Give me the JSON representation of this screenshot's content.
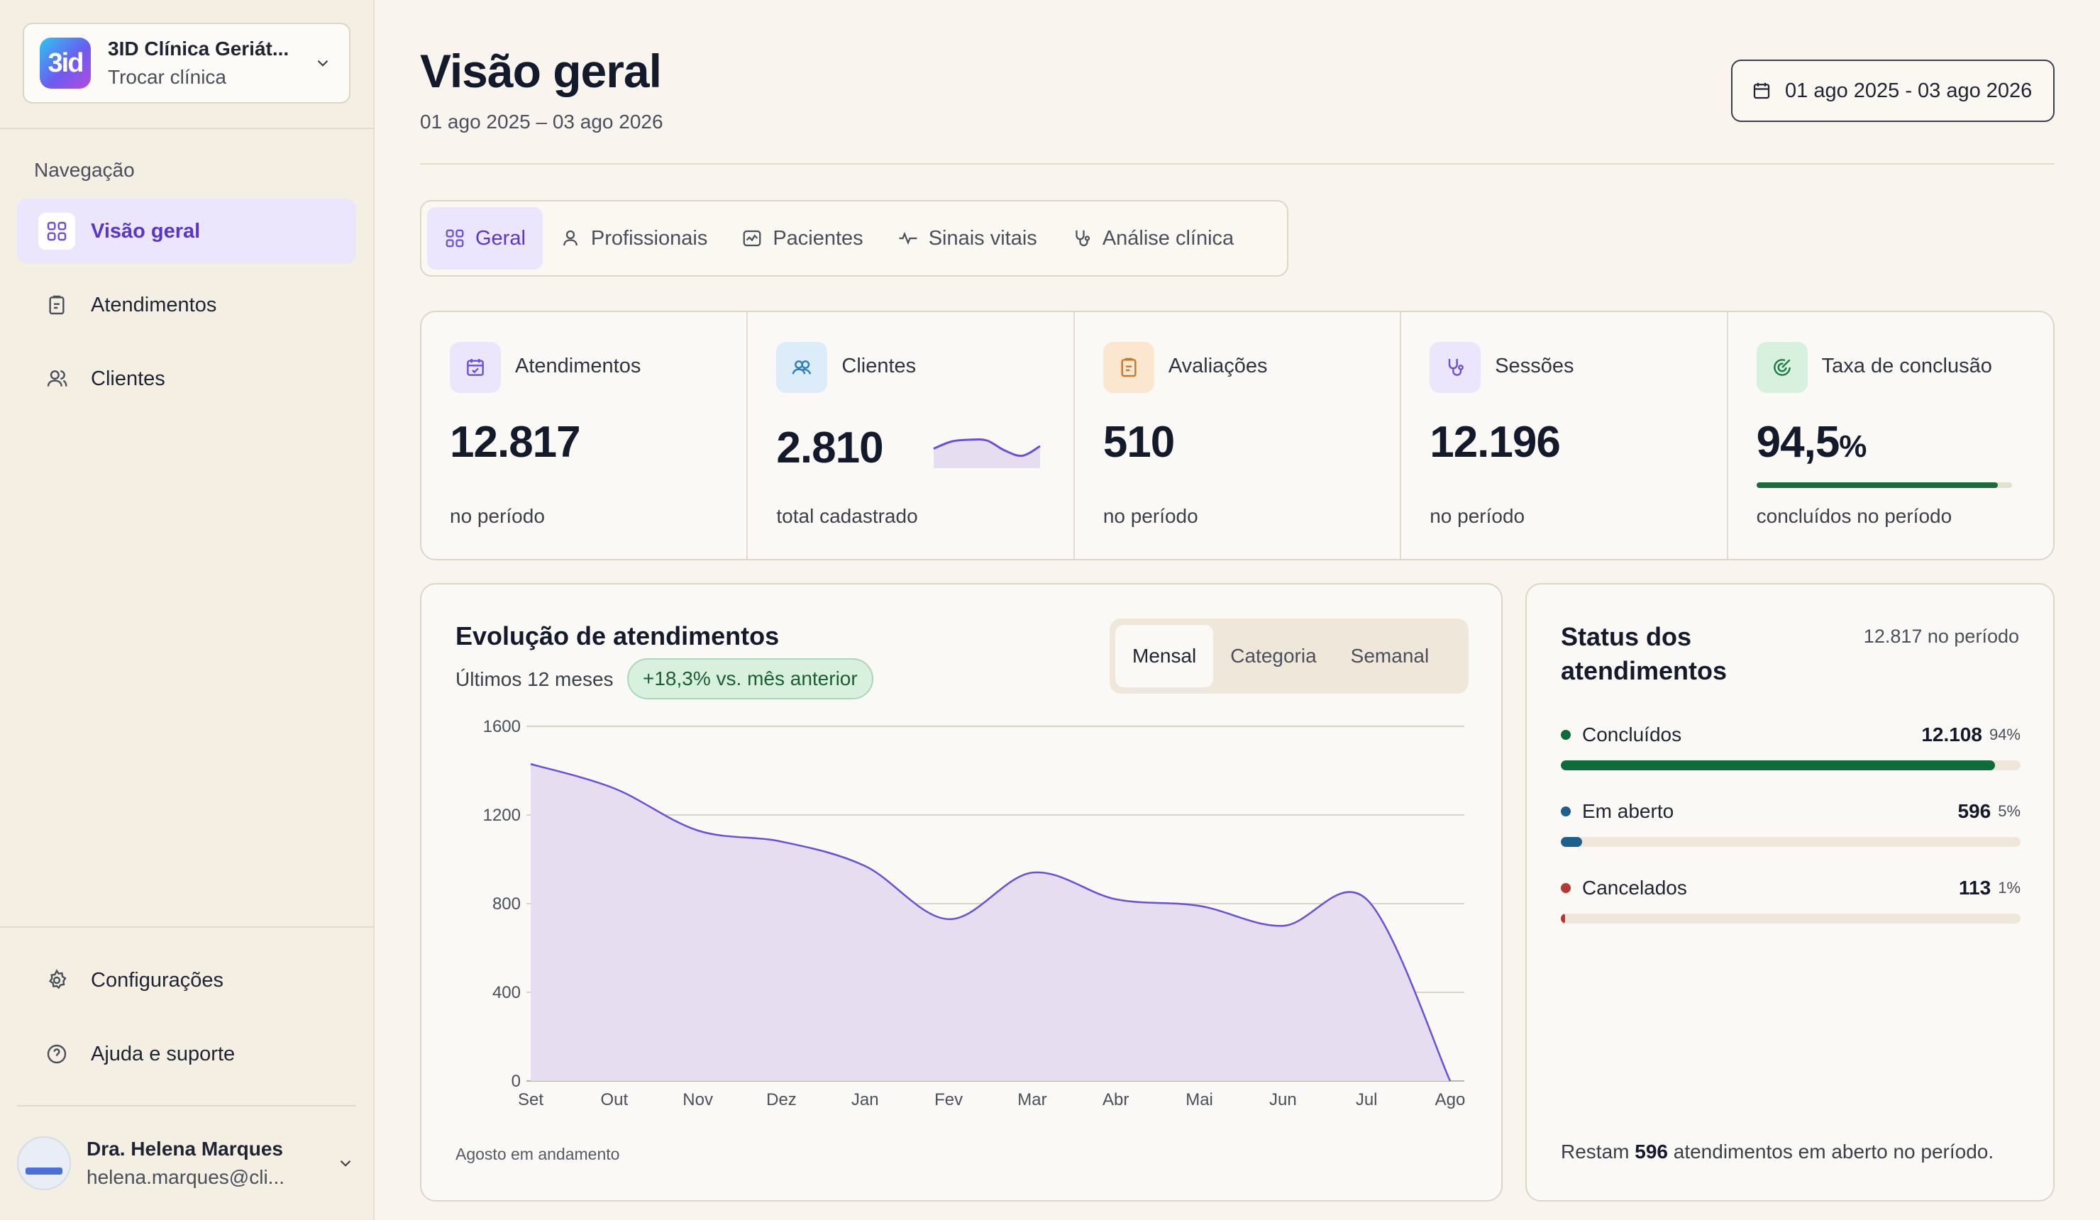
{
  "sidebar": {
    "clinic": {
      "logo_text": "3id",
      "name": "3ID Clínica Geriát...",
      "switch_label": "Trocar clínica"
    },
    "nav_title": "Navegação",
    "items": [
      {
        "label": "Visão geral",
        "icon": "grid-icon",
        "active": true
      },
      {
        "label": "Atendimentos",
        "icon": "clipboard-icon",
        "active": false
      },
      {
        "label": "Clientes",
        "icon": "users-icon",
        "active": false
      }
    ],
    "bottom_items": [
      {
        "label": "Configurações",
        "icon": "gear-icon"
      },
      {
        "label": "Ajuda e suporte",
        "icon": "help-icon"
      }
    ],
    "user": {
      "name": "Dra. Helena Marques",
      "email": "helena.marques@cli..."
    }
  },
  "header": {
    "title": "Visão geral",
    "subtitle": "01 ago 2025 – 03 ago 2026",
    "date_range_button": "01 ago 2025 - 03 ago 2026"
  },
  "tabs": [
    {
      "label": "Geral",
      "icon": "grid-icon",
      "active": true
    },
    {
      "label": "Profissionais",
      "icon": "user-icon",
      "active": false
    },
    {
      "label": "Pacientes",
      "icon": "activity-card-icon",
      "active": false
    },
    {
      "label": "Sinais vitais",
      "icon": "pulse-icon",
      "active": false
    },
    {
      "label": "Análise clínica",
      "icon": "stethoscope-icon",
      "active": false
    }
  ],
  "stats": [
    {
      "label": "Atendimentos",
      "value": "12.817",
      "foot": "no período",
      "icon": "calendar-check-icon",
      "color": "#6b4fd8",
      "bg": "#ebe6fb"
    },
    {
      "label": "Clientes",
      "value": "2.810",
      "foot": "total cadastrado",
      "icon": "users-icon",
      "color": "#2a7fb8",
      "bg": "#dcecf8",
      "sparkline": [
        0.55,
        0.75,
        0.8,
        0.78,
        0.5,
        0.35,
        0.62
      ]
    },
    {
      "label": "Avaliações",
      "value": "510",
      "foot": "no período",
      "icon": "clipboard-icon",
      "color": "#c9782b",
      "bg": "#fbe6cf"
    },
    {
      "label": "Sessões",
      "value": "12.196",
      "foot": "no período",
      "icon": "stethoscope-icon",
      "color": "#6b4fd8",
      "bg": "#ebe6fb"
    },
    {
      "label": "Taxa de conclusão",
      "value": "94,5",
      "unit": "%",
      "foot": "concluídos no período",
      "icon": "target-check-icon",
      "color": "#1c7a45",
      "bg": "#d8f0de",
      "progress": 0.945
    }
  ],
  "evolution": {
    "title": "Evolução de atendimentos",
    "subtitle": "Últimos 12 meses",
    "badge": "+18,3% vs. mês anterior",
    "segments": [
      {
        "label": "Mensal",
        "active": true
      },
      {
        "label": "Categoria",
        "active": false
      },
      {
        "label": "Semanal",
        "active": false
      }
    ],
    "footnote": "Agosto em andamento"
  },
  "chart_data": {
    "type": "area",
    "categories": [
      "Set",
      "Out",
      "Nov",
      "Dez",
      "Jan",
      "Fev",
      "Mar",
      "Abr",
      "Mai",
      "Jun",
      "Jul",
      "Ago"
    ],
    "values": [
      1430,
      1320,
      1130,
      1080,
      970,
      730,
      940,
      820,
      790,
      700,
      820,
      0
    ],
    "ylim": [
      0,
      1600
    ],
    "yticks": [
      0,
      400,
      800,
      1200,
      1600
    ],
    "grid": true,
    "color": "#6b4fd8",
    "fill": "#e6ddf1"
  },
  "status": {
    "title": "Status dos atendimentos",
    "period": "12.817 no período",
    "rows": [
      {
        "name": "Concluídos",
        "count": "12.108",
        "pct": "94%",
        "fraction": 0.945,
        "color": "#0f6b3a"
      },
      {
        "name": "Em aberto",
        "count": "596",
        "pct": "5%",
        "fraction": 0.046,
        "color": "#1f5f8b"
      },
      {
        "name": "Cancelados",
        "count": "113",
        "pct": "1%",
        "fraction": 0.009,
        "color": "#b33a2c"
      }
    ],
    "footer_pre": "Restam",
    "footer_num": "596",
    "footer_post": "atendimentos em aberto no período."
  },
  "colors": {
    "accent": "#5a35c8",
    "background": "#f9f5ee",
    "sidebar": "#f4eee3"
  }
}
